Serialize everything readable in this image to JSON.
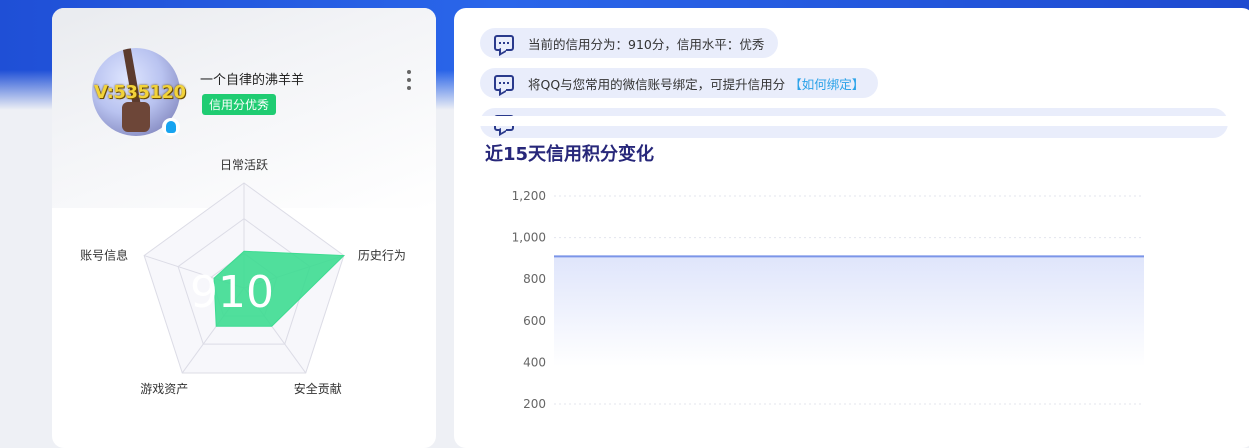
{
  "profile": {
    "nickname": "一个自律的沸羊羊",
    "vip_text": "V:535120",
    "credit_badge": "信用分优秀",
    "score": "910"
  },
  "radar": {
    "labels": [
      "日常活跃",
      "历史行为",
      "安全贡献",
      "游戏资产",
      "账号信息"
    ],
    "values": [
      0.35,
      1.0,
      0.45,
      0.45,
      0.3
    ],
    "fill_color": "#3ddc91"
  },
  "messages": [
    {
      "text": "当前的信用分为：910分，信用水平：优秀",
      "link": ""
    },
    {
      "text": "将QQ与您常用的微信账号绑定，可提升信用分",
      "link": "【如何绑定】"
    },
    {
      "text": "",
      "link": ""
    }
  ],
  "chart_data": {
    "type": "area",
    "title": "近15天信用积分变化",
    "ylim": [
      200,
      1200
    ],
    "yticks": [
      "1,200",
      "1,000",
      "800",
      "600",
      "400",
      "200"
    ],
    "series": [
      {
        "values": [
          910,
          910,
          910,
          910,
          910,
          910,
          910,
          910,
          910,
          910,
          910,
          910,
          910,
          910,
          910
        ]
      }
    ],
    "grid": true,
    "line_color": "#7b95e8"
  }
}
